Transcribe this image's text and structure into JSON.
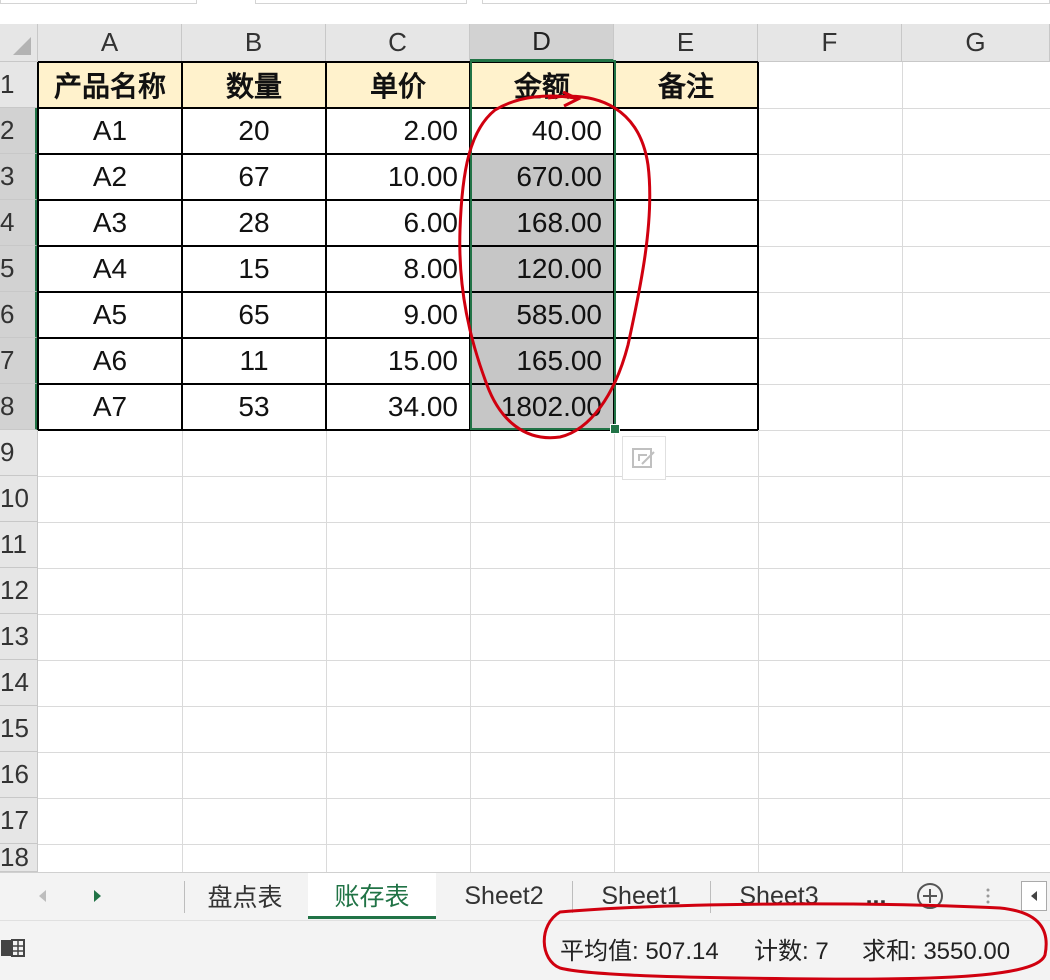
{
  "columns": [
    "A",
    "B",
    "C",
    "D",
    "E",
    "F",
    "G"
  ],
  "row_numbers": [
    "1",
    "2",
    "3",
    "4",
    "5",
    "6",
    "7",
    "8",
    "9",
    "10",
    "11",
    "12",
    "13",
    "14",
    "15",
    "16",
    "17",
    "18"
  ],
  "table": {
    "headers": [
      "产品名称",
      "数量",
      "单价",
      "金额",
      "备注"
    ],
    "rows": [
      {
        "name": "A1",
        "qty": "20",
        "price": "2.00",
        "amount": "40.00",
        "note": ""
      },
      {
        "name": "A2",
        "qty": "67",
        "price": "10.00",
        "amount": "670.00",
        "note": ""
      },
      {
        "name": "A3",
        "qty": "28",
        "price": "6.00",
        "amount": "168.00",
        "note": ""
      },
      {
        "name": "A4",
        "qty": "15",
        "price": "8.00",
        "amount": "120.00",
        "note": ""
      },
      {
        "name": "A5",
        "qty": "65",
        "price": "9.00",
        "amount": "585.00",
        "note": ""
      },
      {
        "name": "A6",
        "qty": "11",
        "price": "15.00",
        "amount": "165.00",
        "note": ""
      },
      {
        "name": "A7",
        "qty": "53",
        "price": "34.00",
        "amount": "1802.00",
        "note": ""
      }
    ]
  },
  "selection": {
    "column": "D",
    "rows": "2-8"
  },
  "sheet_tabs": [
    "盘点表",
    "账存表",
    "Sheet2",
    "Sheet1",
    "Sheet3"
  ],
  "active_tab": "账存表",
  "tabs_more": "...",
  "status": {
    "average": "平均值: 507.14",
    "count": "计数: 7",
    "sum": "求和: 3550.00"
  },
  "icons": {
    "tab_scroll_left": "triangle-left-icon",
    "tab_scroll_right": "triangle-right-icon",
    "add_sheet": "plus-circle-icon",
    "quick_analysis": "quick-analysis-icon",
    "cell_mode": "sheet-mode-icon"
  },
  "colors": {
    "header_fill": "#fff2cc",
    "selection_fill": "#c6c6c6",
    "accent": "#217346",
    "annotation": "#d0000f"
  }
}
